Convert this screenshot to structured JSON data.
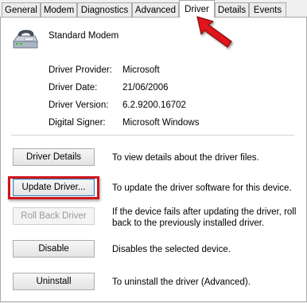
{
  "tabs": [
    {
      "label": "General"
    },
    {
      "label": "Modem"
    },
    {
      "label": "Diagnostics"
    },
    {
      "label": "Advanced"
    },
    {
      "label": "Driver"
    },
    {
      "label": "Details"
    },
    {
      "label": "Events"
    }
  ],
  "device": {
    "name": "Standard Modem",
    "icon": "modem-icon"
  },
  "info": {
    "provider_label": "Driver Provider:",
    "provider_value": "Microsoft",
    "date_label": "Driver Date:",
    "date_value": "21/06/2006",
    "version_label": "Driver Version:",
    "version_value": "6.2.9200.16702",
    "signer_label": "Digital Signer:",
    "signer_value": "Microsoft Windows"
  },
  "actions": {
    "details_label": "Driver Details",
    "details_desc": "To view details about the driver files.",
    "update_label": "Update Driver...",
    "update_desc": "To update the driver software for this device.",
    "rollback_label": "Roll Back Driver",
    "rollback_desc": "If the device fails after updating the driver, roll back to the previously installed driver.",
    "disable_label": "Disable",
    "disable_desc": "Disables the selected device.",
    "uninstall_label": "Uninstall",
    "uninstall_desc": "To uninstall the driver (Advanced)."
  },
  "annotation_colors": {
    "highlight": "#d0151c",
    "arrow": "#e0131a"
  }
}
